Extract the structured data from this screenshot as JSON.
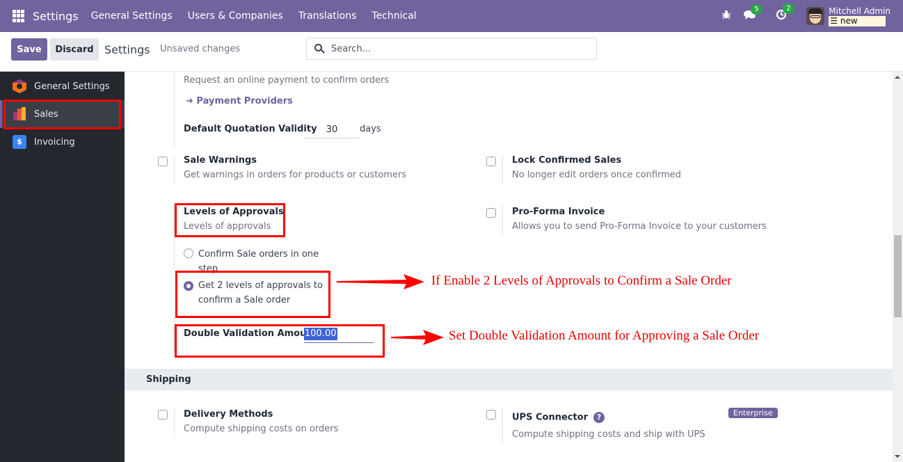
{
  "navbar": {
    "app_title": "Settings",
    "menu": [
      "General Settings",
      "Users & Companies",
      "Translations",
      "Technical"
    ],
    "icons": {
      "apps": "grid-icon",
      "debug": "bug-icon",
      "messages": "chat-icon",
      "activities": "clock-icon"
    },
    "messages_count": "5",
    "activities_count": "2",
    "user_name": "Mitchell Admin",
    "database": "new",
    "database_icon": "database-icon"
  },
  "control_panel": {
    "save_label": "Save",
    "discard_label": "Discard",
    "title": "Settings",
    "status": "Unsaved changes",
    "search_placeholder": "Search..."
  },
  "sidebar": {
    "items": [
      {
        "label": "General Settings",
        "icon": "general-settings-icon",
        "active": false
      },
      {
        "label": "Sales",
        "icon": "sales-icon",
        "active": true
      },
      {
        "label": "Invoicing",
        "icon": "invoicing-icon",
        "active": false
      }
    ]
  },
  "settings": {
    "online_payment_desc": "Request an online payment to confirm orders",
    "payment_providers_link": "Payment Providers",
    "quotation_validity_label": "Default Quotation Validity",
    "quotation_validity_value": "30",
    "quotation_validity_unit": "days",
    "sale_warnings": {
      "title": "Sale Warnings",
      "desc": "Get warnings in orders for products or customers",
      "checked": false
    },
    "lock_confirmed": {
      "title": "Lock Confirmed Sales",
      "desc": "No longer edit orders once confirmed",
      "checked": false
    },
    "levels_of_approvals": {
      "title": "Levels of Approvals",
      "desc": "Levels of approvals",
      "options": [
        {
          "label": "Confirm Sale orders in one step",
          "checked": false
        },
        {
          "label": "Get 2 levels of approvals to confirm a Sale order",
          "checked": true
        }
      ],
      "double_validation_label": "Double Validation Amount",
      "double_validation_value": "100.00"
    },
    "pro_forma": {
      "title": "Pro-Forma Invoice",
      "desc": "Allows you to send Pro-Forma Invoice to your customers",
      "checked": false
    }
  },
  "shipping": {
    "section_title": "Shipping",
    "delivery_methods": {
      "title": "Delivery Methods",
      "desc": "Compute shipping costs on orders",
      "checked": false
    },
    "ups_connector": {
      "title": "UPS Connector",
      "desc": "Compute shipping costs and ship with UPS",
      "checked": false,
      "badge": "Enterprise",
      "help_icon": "?"
    }
  },
  "annotations": {
    "approval_note": "If Enable 2 Levels of Approvals to Confirm a Sale Order",
    "amount_note": "Set Double Validation Amount for Approving a Sale Order",
    "highlight_color": "#ff0000"
  }
}
